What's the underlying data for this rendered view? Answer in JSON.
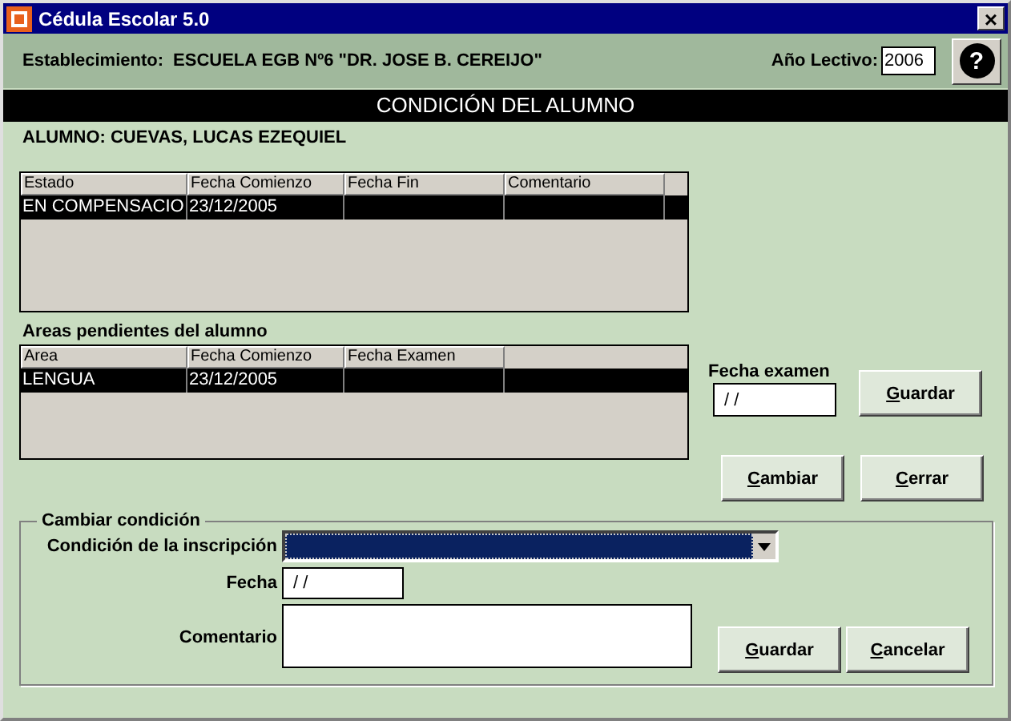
{
  "window": {
    "title": "Cédula Escolar 5.0",
    "close": "×"
  },
  "header": {
    "label": "Establecimiento:",
    "school": "ESCUELA EGB Nº6 \"DR. JOSE B. CEREIJO\"",
    "year_label": "Año Lectivo:",
    "year": "2006",
    "help": "?"
  },
  "banner": "CONDICIÓN DEL ALUMNO",
  "student": "ALUMNO: CUEVAS, LUCAS EZEQUIEL",
  "conditions_table": {
    "columns": [
      "Estado",
      "Fecha Comienzo",
      "Fecha Fin",
      "Comentario"
    ],
    "rows": [
      {
        "cells": [
          "EN COMPENSACIO",
          "23/12/2005",
          "",
          ""
        ],
        "selected": true
      }
    ]
  },
  "areas_title": "Areas pendientes del alumno",
  "areas_table": {
    "columns": [
      "Area",
      "Fecha Comienzo",
      "Fecha Examen"
    ],
    "rows": [
      {
        "cells": [
          "LENGUA",
          "23/12/2005",
          ""
        ],
        "selected": true
      }
    ]
  },
  "exam": {
    "label": "Fecha examen",
    "value": "/ /",
    "button": "Guardar"
  },
  "actions": [
    "Cambiar",
    "Cerrar"
  ],
  "change": {
    "title": "Cambiar condición",
    "condition_label": "Condición de la inscripción",
    "date_label": "Fecha",
    "date_value": "/ /",
    "comment_label": "Comentario",
    "buttons": [
      "Guardar",
      "Cancelar"
    ]
  }
}
